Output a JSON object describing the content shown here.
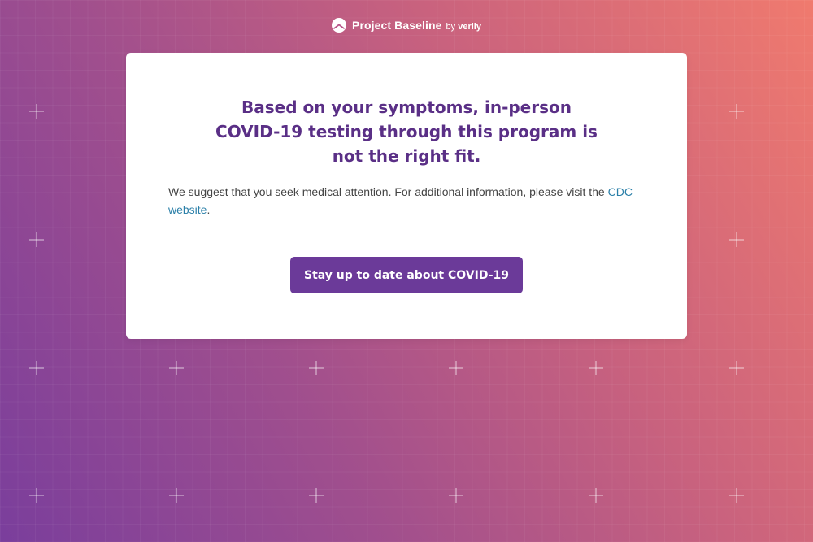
{
  "header": {
    "brand": "Project Baseline",
    "by_prefix": "by",
    "by_company": "verily",
    "logo_icon": "baseline-logo-icon"
  },
  "card": {
    "title": "Based on your symptoms, in-person COVID-19 testing through this program is not the right fit.",
    "body_prefix": "We suggest that you seek medical attention. For additional information, please visit the",
    "link_text": "CDC website",
    "body_suffix": ".",
    "cta_label": "Stay up to date about COVID-19"
  },
  "colors": {
    "accent": "#6b3a99",
    "title": "#5a2f86",
    "link": "#2a7fa8",
    "background_start": "#7a3e9c",
    "background_end": "#f07a6e"
  }
}
